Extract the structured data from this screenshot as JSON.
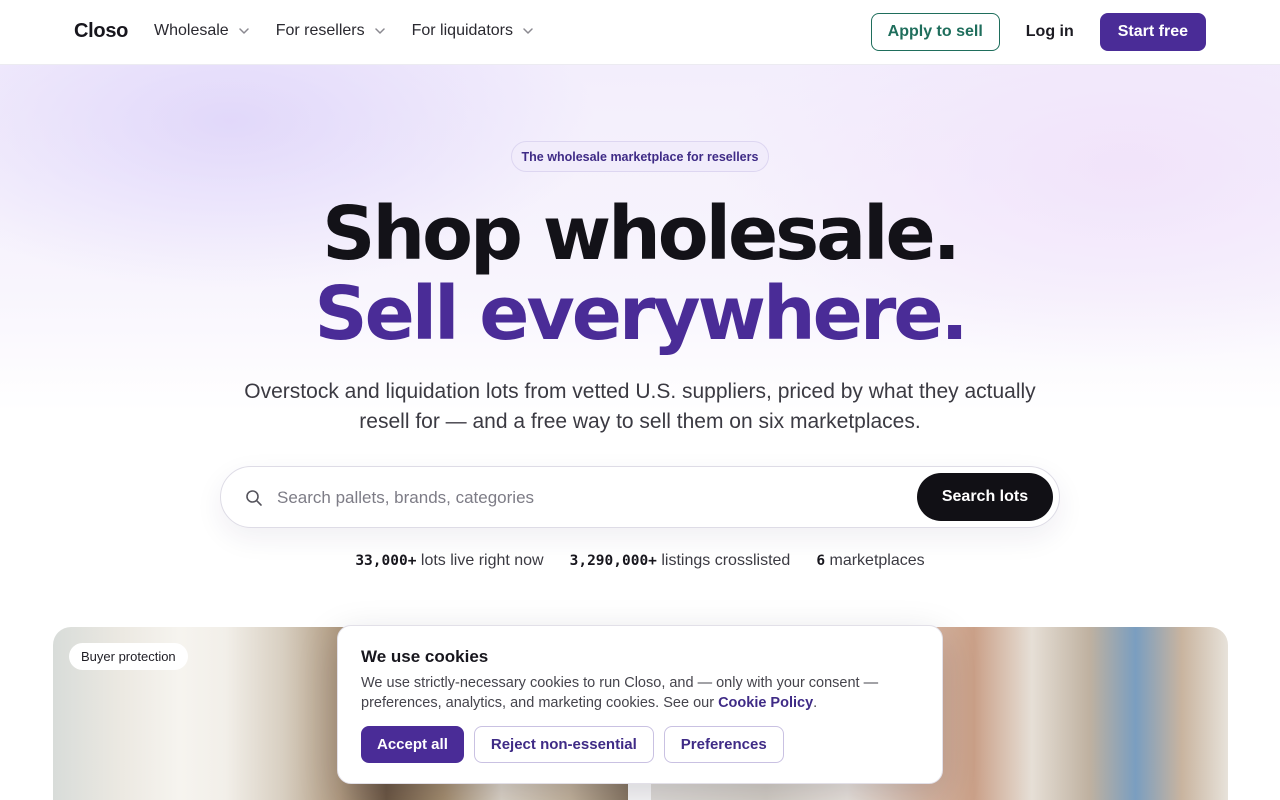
{
  "header": {
    "logo": "Closo",
    "nav": [
      {
        "label": "Wholesale"
      },
      {
        "label": "For resellers"
      },
      {
        "label": "For liquidators"
      }
    ],
    "apply_label": "Apply to sell",
    "login_label": "Log in",
    "start_label": "Start free",
    "colors": {
      "apply": "#1f6e5c",
      "primary": "#4a2c97"
    }
  },
  "hero": {
    "pill": "The wholesale marketplace for resellers",
    "headline_1": "Shop wholesale.",
    "headline_2": "Sell everywhere.",
    "subtitle": "Overstock and liquidation lots from vetted U.S. suppliers, priced by what they actually resell for — and a free way to sell them on six marketplaces.",
    "search": {
      "placeholder": "Search pallets, brands, categories",
      "button": "Search lots",
      "icon": "search-icon"
    },
    "stats": [
      {
        "value": "33,000+",
        "label": "lots live right now"
      },
      {
        "value": "3,290,000+",
        "label": "listings crosslisted"
      },
      {
        "value": "6",
        "label": "marketplaces"
      }
    ]
  },
  "images": {
    "badge": "Buyer protection"
  },
  "cookie": {
    "title": "We use cookies",
    "text": "We use strictly-necessary cookies to run Closo, and — only with your consent — preferences, analytics, and marketing cookies. See our ",
    "link": "Cookie Policy",
    "text_end": ".",
    "accept": "Accept all",
    "reject": "Reject non-essential",
    "preferences": "Preferences"
  }
}
